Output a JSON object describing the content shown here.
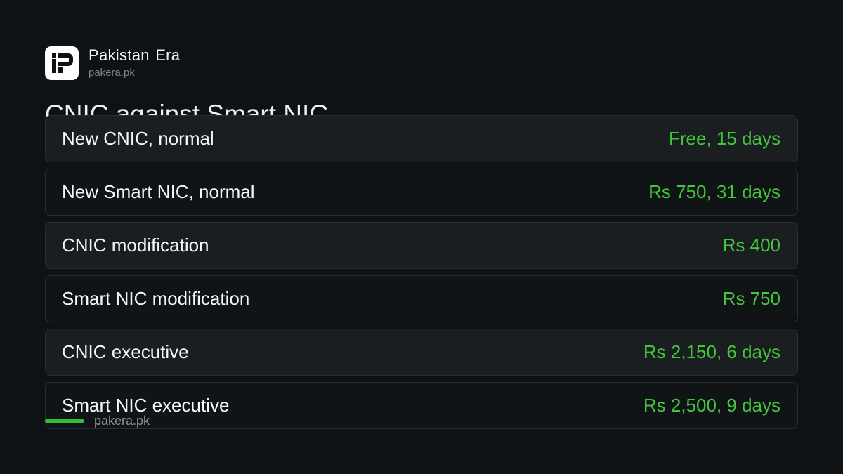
{
  "brand": {
    "name": "Pakistan Era",
    "url": "pakera.pk"
  },
  "title": "CNIC against Smart NIC",
  "rows": [
    {
      "label": "New CNIC, normal",
      "value": "Free, 15 days"
    },
    {
      "label": "New Smart NIC, normal",
      "value": "Rs 750, 31 days"
    },
    {
      "label": "CNIC modification",
      "value": "Rs 400"
    },
    {
      "label": "Smart NIC modification",
      "value": "Rs 750"
    },
    {
      "label": "CNIC executive",
      "value": "Rs 2,150, 6 days"
    },
    {
      "label": "Smart NIC executive",
      "value": "Rs 2,500, 9 days"
    }
  ],
  "footer": {
    "url": "pakera.pk"
  },
  "colors": {
    "background": "#0f1214",
    "accent": "#43c63c",
    "footer_bar": "#2fbe35",
    "row_shade": "#1a1e21"
  },
  "icons": {
    "logo": "pakistan-era-logo-icon"
  }
}
